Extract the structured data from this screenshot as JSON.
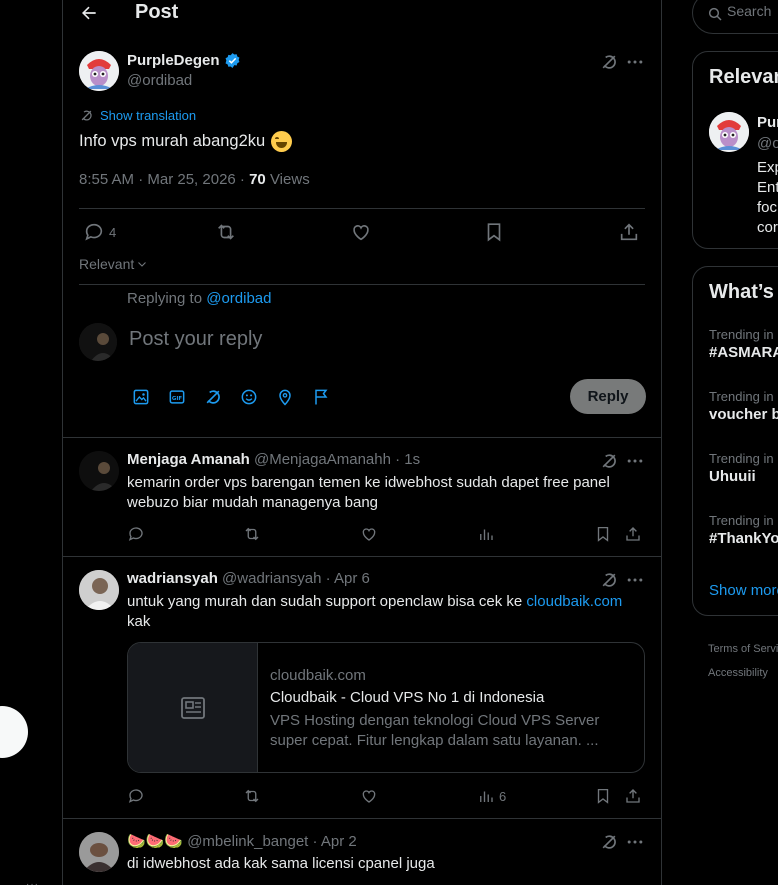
{
  "header": {
    "title": "Post"
  },
  "post": {
    "author_name": "PurpleDegen",
    "author_handle": "@ordibad",
    "show_translation": "Show translation",
    "text": "Info vps murah abang2ku",
    "emoji": "laughing-face",
    "time": "8:55 AM · Mar 25, 2026 · ",
    "views_count": "70",
    "views_label": " Views",
    "reply_count": "4",
    "sort_label": "Relevant"
  },
  "compose": {
    "replying_prefix": "Replying to ",
    "replying_handle": "@ordibad",
    "placeholder": "Post your reply",
    "reply_button": "Reply"
  },
  "replies": [
    {
      "name": "Menjaga Amanah",
      "handle_time": "@MenjagaAmanahh · 1s",
      "text": "kemarin order vps barengan temen ke idwebhost sudah dapet free panel webuzo biar mudah managenya bang",
      "views": ""
    },
    {
      "name": "wadriansyah",
      "handle_time": "@wadriansyah · Apr 6",
      "text": "untuk yang murah dan sudah support openclaw bisa cek ke ",
      "link": "cloudbaik.com",
      "text_after": " kak",
      "views": "6",
      "card": {
        "domain": "cloudbaik.com",
        "title": "Cloudbaik - Cloud VPS No 1 di Indonesia",
        "description": "VPS Hosting dengan teknologi Cloud VPS Server super cepat. Fitur lengkap dalam satu layanan. ..."
      }
    },
    {
      "name": "🍉🍉🍉",
      "handle_time": "@mbelink_banget · Apr 2",
      "text": "di idwebhost ada kak sama licensi cpanel juga"
    }
  ],
  "sidebar": {
    "search_placeholder": "Search",
    "relevant_title": "Relevant people",
    "relevant_person": {
      "name": "PurpleDegen",
      "handle": "@ordibad",
      "bio": "Exp\nEnt\nfoc\ncor"
    },
    "whats_title": "What’s happening",
    "trends": [
      {
        "category": "Trending in Indonesia",
        "name": "#ASMARA"
      },
      {
        "category": "Trending in Indonesia",
        "name": "voucher b"
      },
      {
        "category": "Trending in Indonesia",
        "name": "Uhuuii"
      },
      {
        "category": "Trending in Indonesia",
        "name": "#ThankYo"
      }
    ],
    "show_more": "Show more",
    "footer": [
      "Terms of Service",
      "Accessibility"
    ]
  },
  "colors": {
    "accent": "#1d9bf0",
    "verified": "#1d9bf0",
    "background": "#000000",
    "border": "#2f3336",
    "muted": "#71767b"
  }
}
